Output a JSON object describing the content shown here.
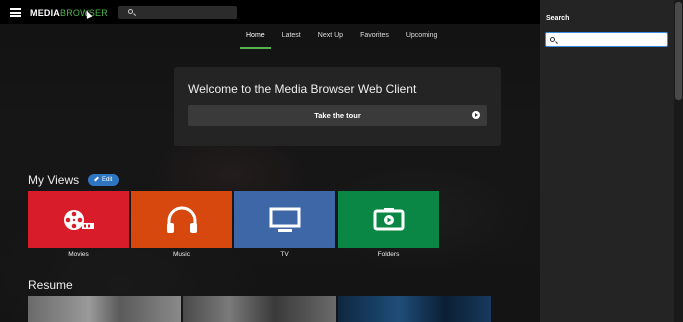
{
  "header": {
    "menu_icon": "hamburger-icon",
    "logo_part1": "MEDIA",
    "logo_part2": "BROWSER",
    "search_icon": "search-icon"
  },
  "tabs": [
    {
      "label": "Home",
      "active": true
    },
    {
      "label": "Latest",
      "active": false
    },
    {
      "label": "Next Up",
      "active": false
    },
    {
      "label": "Favorites",
      "active": false
    },
    {
      "label": "Upcoming",
      "active": false
    }
  ],
  "welcome": {
    "title": "Welcome to the Media Browser Web Client",
    "tour_label": "Take the tour",
    "tour_icon": "arrow-right-circle-icon"
  },
  "my_views": {
    "title": "My Views",
    "edit_label": "Edit",
    "edit_icon": "pencil-icon",
    "tiles": [
      {
        "label": "Movies",
        "color": "#d91c2a",
        "icon": "film-reel-icon"
      },
      {
        "label": "Music",
        "color": "#d6480d",
        "icon": "headphones-icon"
      },
      {
        "label": "TV",
        "color": "#3e67a8",
        "icon": "tv-icon"
      },
      {
        "label": "Folders",
        "color": "#0b8745",
        "icon": "folder-video-icon"
      }
    ]
  },
  "resume": {
    "title": "Resume"
  },
  "search_panel": {
    "title": "Search",
    "input_value": "",
    "search_icon": "search-icon"
  },
  "colors": {
    "accent": "#52b54b",
    "edit_button": "#2f76c2",
    "input_focus": "#3b8ede"
  }
}
